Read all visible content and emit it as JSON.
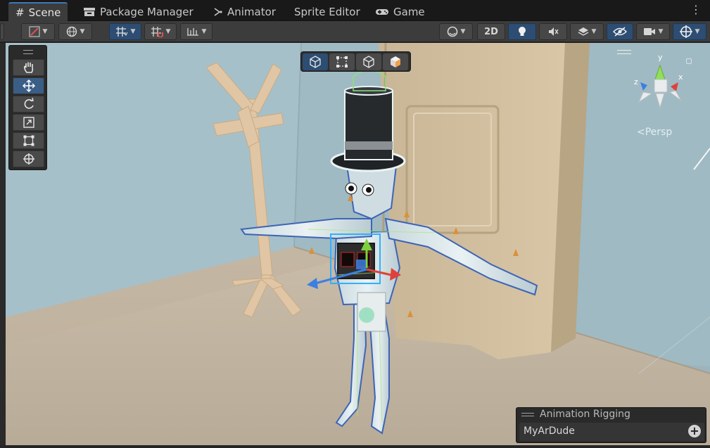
{
  "tabs": [
    {
      "label": "Scene",
      "icon": "hash-grid-icon",
      "active": true
    },
    {
      "label": "Package Manager",
      "icon": "package-icon",
      "active": false
    },
    {
      "label": "Animator",
      "icon": "animator-icon",
      "active": false
    },
    {
      "label": "Sprite Editor",
      "icon": "",
      "active": false
    },
    {
      "label": "Game",
      "icon": "gamepad-icon",
      "active": false
    }
  ],
  "tab_menu": "⋮",
  "toolbar": {
    "mode_2d_label": "2D"
  },
  "tool_palette": [
    "hand-tool",
    "move-tool",
    "rotate-tool",
    "scale-tool",
    "rect-tool",
    "transform-tool"
  ],
  "active_tool": "move-tool",
  "gizmo": {
    "axis_y": "y",
    "axis_x": "x",
    "axis_z": "z",
    "projection_label": "Persp"
  },
  "animation_rigging": {
    "title": "Animation Rigging",
    "rig_name": "MyArDude"
  },
  "colors": {
    "accent": "#3a79bb",
    "selected": "#2d4d72",
    "axis_x": "#e0403a",
    "axis_y": "#7fd13b",
    "axis_z": "#3d7fe0"
  }
}
